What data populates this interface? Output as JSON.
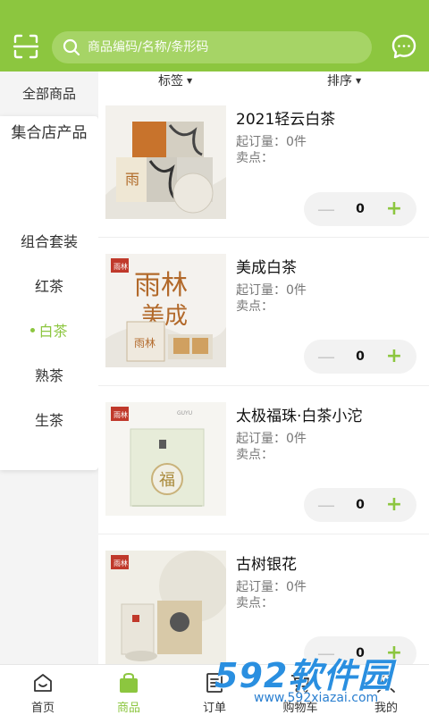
{
  "header": {
    "search_placeholder": "商品编码/名称/条形码"
  },
  "sidebar": {
    "all": "全部商品",
    "active": "集合店产品",
    "items": [
      {
        "label": "组合套装",
        "selected": false
      },
      {
        "label": "红茶",
        "selected": false
      },
      {
        "label": "白茶",
        "selected": true
      },
      {
        "label": "熟茶",
        "selected": false
      },
      {
        "label": "生茶",
        "selected": false
      }
    ]
  },
  "filters": {
    "tag": "标签",
    "sort": "排序"
  },
  "products": [
    {
      "name": "2021轻云白茶",
      "min_order": "起订量：0件",
      "selling_point": "卖点：",
      "qty": "0",
      "thumb_text": "雨林"
    },
    {
      "name": "美成白茶",
      "min_order": "起订量：0件",
      "selling_point": "卖点：",
      "qty": "0",
      "thumb_text": "雨林美成"
    },
    {
      "name": "太极福珠·白茶小沱",
      "min_order": "起订量：0件",
      "selling_point": "卖点：",
      "qty": "0",
      "thumb_text": "福"
    },
    {
      "name": "古树银花",
      "min_order": "起订量：0件",
      "selling_point": "卖点：",
      "qty": "0",
      "thumb_text": "雨林"
    }
  ],
  "tabbar": {
    "tabs": [
      {
        "label": "首页",
        "icon": "home-icon",
        "active": false
      },
      {
        "label": "商品",
        "icon": "bag-icon",
        "active": true
      },
      {
        "label": "订单",
        "icon": "order-icon",
        "active": false
      },
      {
        "label": "购物车",
        "icon": "cart-icon",
        "active": false
      },
      {
        "label": "我的",
        "icon": "user-icon",
        "active": false
      }
    ]
  },
  "watermark": {
    "brand": "592软件园",
    "url": "www.592xiazai.com"
  },
  "colors": {
    "accent": "#8cc63f",
    "watermark": "#2a8fe0"
  }
}
